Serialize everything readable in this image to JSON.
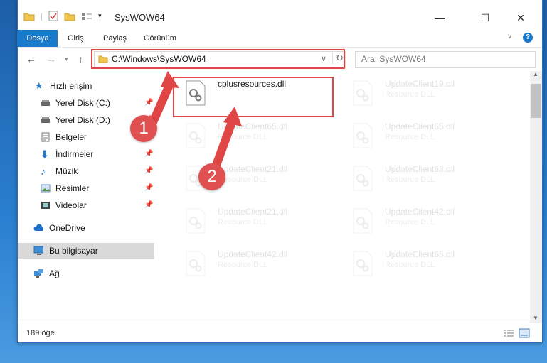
{
  "window": {
    "title": "SysWOW64",
    "controls": {
      "minimize": "—",
      "maximize": "☐",
      "close": "✕"
    }
  },
  "ribbon": {
    "tabs": [
      {
        "label": "Dosya"
      },
      {
        "label": "Giriş"
      },
      {
        "label": "Paylaş"
      },
      {
        "label": "Görünüm"
      }
    ]
  },
  "address": {
    "path": "C:\\Windows\\SysWOW64",
    "search_placeholder": "Ara: SysWOW64"
  },
  "sidebar": {
    "items": [
      {
        "label": "Hızlı erişim"
      },
      {
        "label": "Yerel Disk (C:)"
      },
      {
        "label": "Yerel Disk (D:)"
      },
      {
        "label": "Belgeler"
      },
      {
        "label": "İndirmeler"
      },
      {
        "label": "Müzik"
      },
      {
        "label": "Resimler"
      },
      {
        "label": "Videolar"
      },
      {
        "label": "OneDrive"
      },
      {
        "label": "Bu bilgisayar"
      },
      {
        "label": "Ağ"
      }
    ]
  },
  "files": [
    {
      "name": "cplusresources.dll",
      "type": ""
    },
    {
      "name": "UpdateClient19.dll",
      "type": "Resource DLL"
    },
    {
      "name": "UpdateClient65.dll",
      "type": "Resource DLL"
    },
    {
      "name": "UpdateClient65.dll",
      "type": "Resource DLL"
    },
    {
      "name": "UpdateClient21.dll",
      "type": "Resource DLL"
    },
    {
      "name": "UpdateClient63.dll",
      "type": "Resource DLL"
    },
    {
      "name": "UpdateClient21.dll",
      "type": "Resource DLL"
    },
    {
      "name": "UpdateClient42.dll",
      "type": "Resource DLL"
    },
    {
      "name": "UpdateClient42.dll",
      "type": "Resource DLL"
    },
    {
      "name": "UpdateClient65.dll",
      "type": "Resource DLL"
    }
  ],
  "status": {
    "count": "189 öğe"
  },
  "callouts": {
    "one": "1",
    "two": "2"
  },
  "colors": {
    "accent": "#1979ca",
    "highlight": "#e04646"
  }
}
